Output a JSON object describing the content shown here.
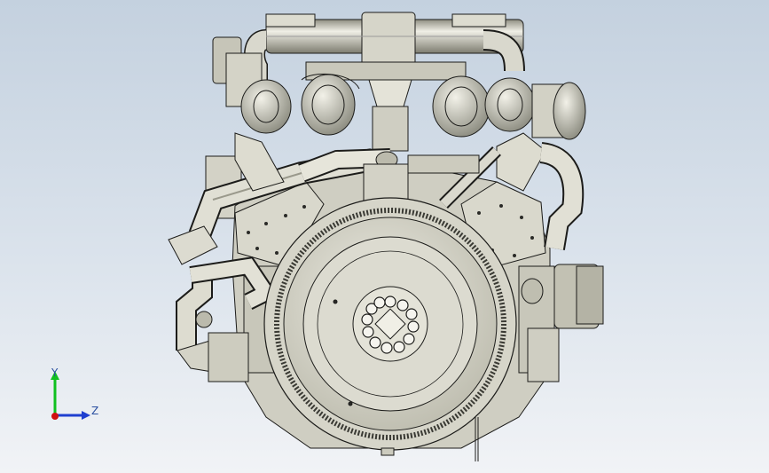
{
  "viewport": {
    "background_top": "#c4d1df",
    "background_bottom": "#f1f3f6"
  },
  "model": {
    "metal_light": "#e6e5da",
    "metal_mid": "#b9b8a8",
    "metal_dark": "#6e6d62",
    "outline": "#1c1c1a"
  },
  "triad": {
    "y_label": "Y",
    "z_label": "Z",
    "y_color": "#10c020",
    "z_color": "#1f3fd0",
    "x_color": "#d01010",
    "label_color": "#2a4fa0"
  }
}
